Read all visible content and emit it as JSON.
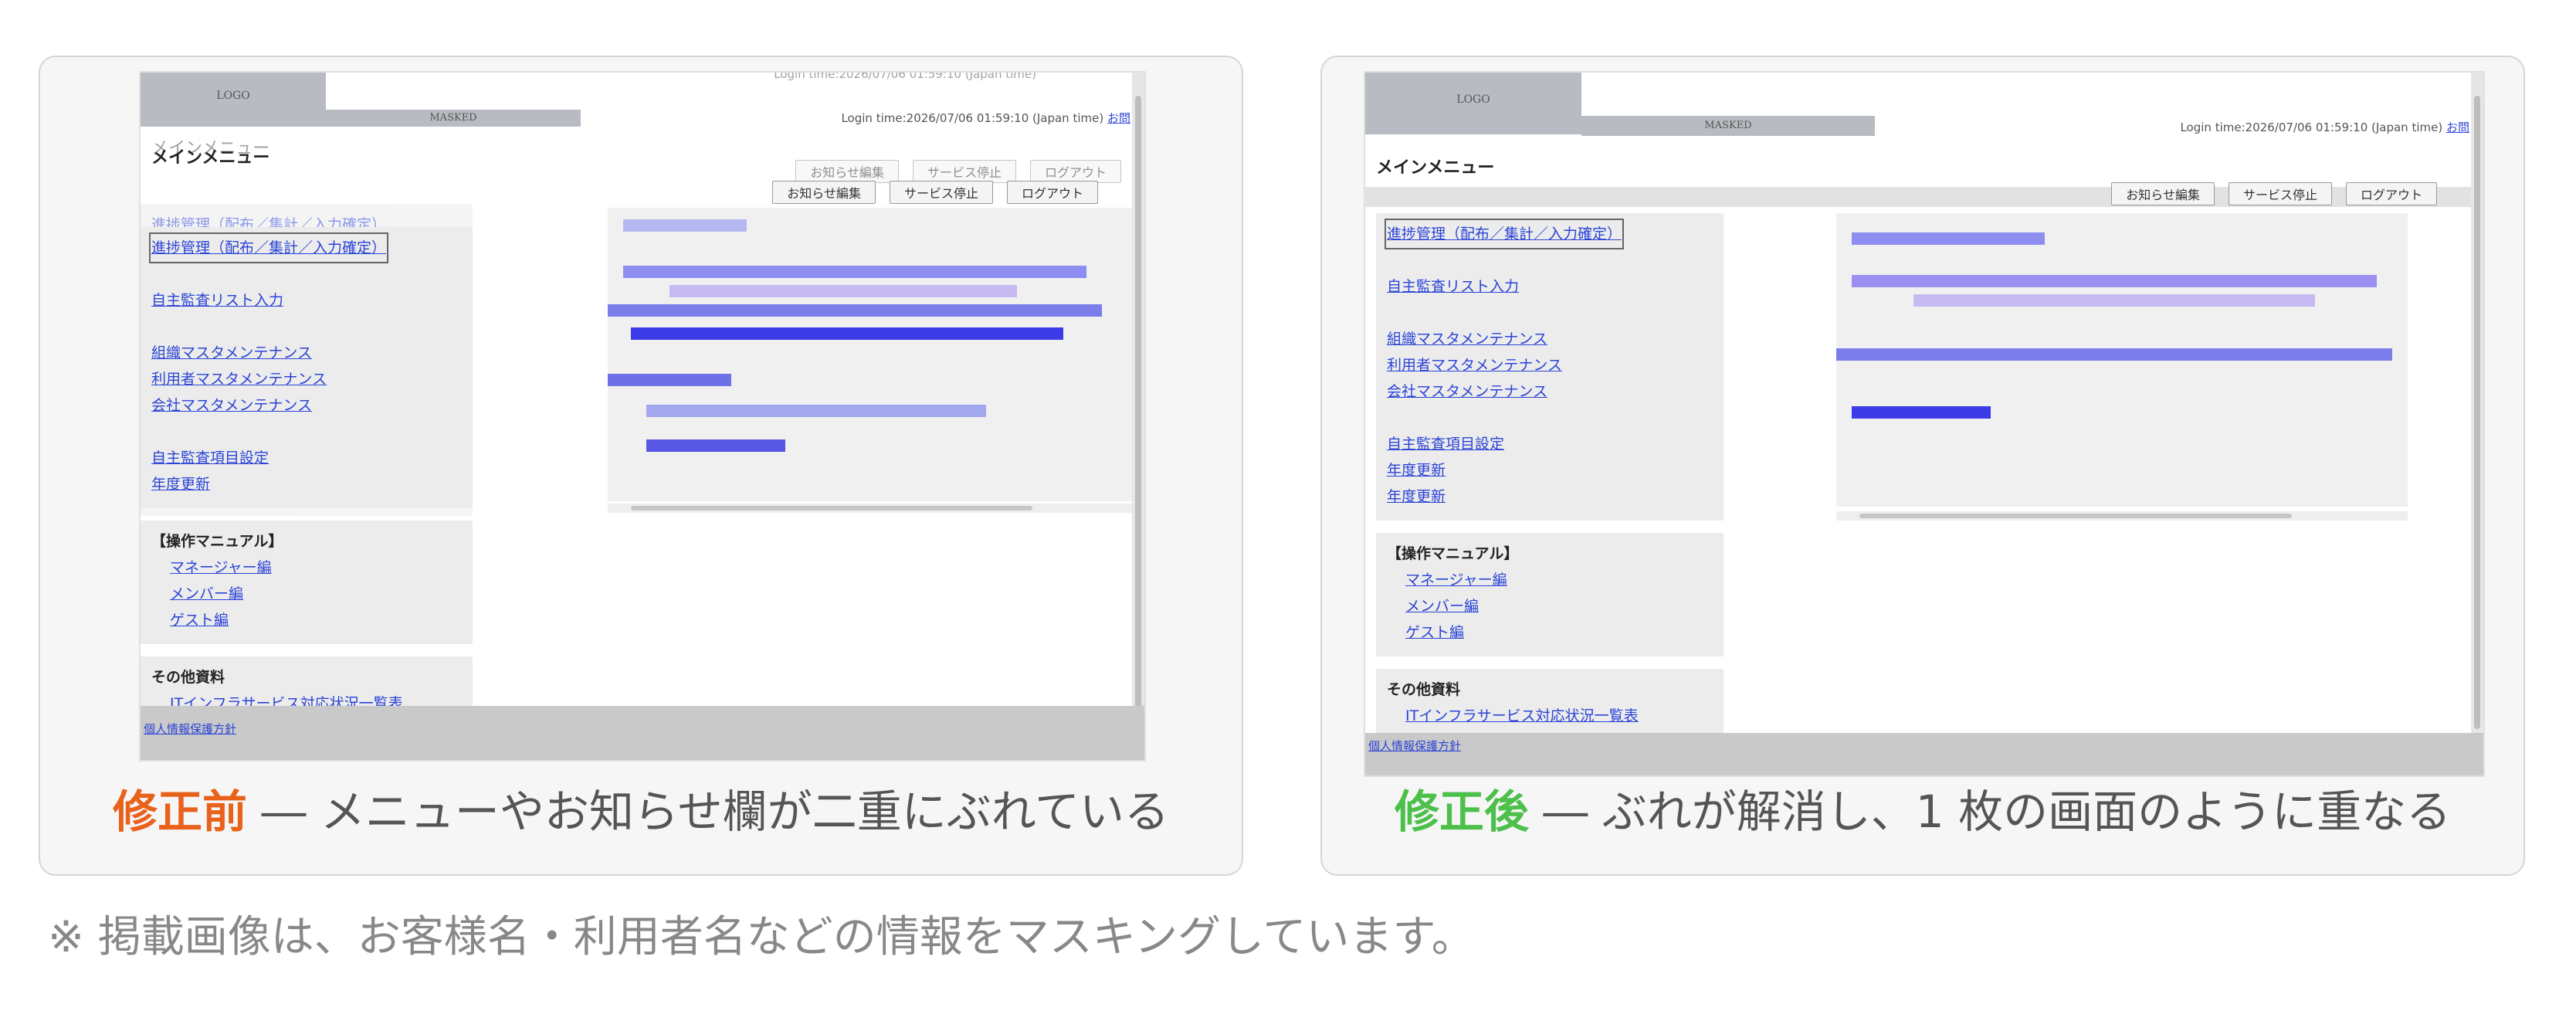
{
  "colors": {
    "before_accent": "#e8621c",
    "after_accent": "#4cc04a",
    "link": "#2b44d6"
  },
  "screenshot": {
    "logo": "LOGO",
    "masked": "MASKED",
    "login_time": "Login time:2026/07/06 01:59:10 (Japan time)",
    "help": "お問",
    "menu_title": "メインメニュー",
    "buttons": [
      "お知らせ編集",
      "サービス停止",
      "ログアウト"
    ],
    "menu_links": [
      "進捗管理（配布／集計／入力確定）",
      "自主監査リスト入力",
      "組織マスタメンテナンス",
      "利用者マスタメンテナンス",
      "会社マスタメンテナンス",
      "自主監査項目設定",
      "年度更新",
      "年度更新"
    ],
    "manual_title": "【操作マニュアル】",
    "manual_links": [
      "マネージャー編",
      "メンバー編",
      "ゲスト編"
    ],
    "other_title": "その他資料",
    "other_links": [
      "ITインフラサービス対応状況一覧表"
    ],
    "privacy": "個人情報保護方針"
  },
  "before": {
    "tag": "修正前",
    "caption": " ― メニューやお知らせ欄が二重にぶれている"
  },
  "after": {
    "tag": "修正後",
    "caption": " ― ぶれが解消し、1 枚の画面のように重なる"
  },
  "note": "※ 掲載画像は、お客様名・利用者名などの情報をマスキングしています。"
}
